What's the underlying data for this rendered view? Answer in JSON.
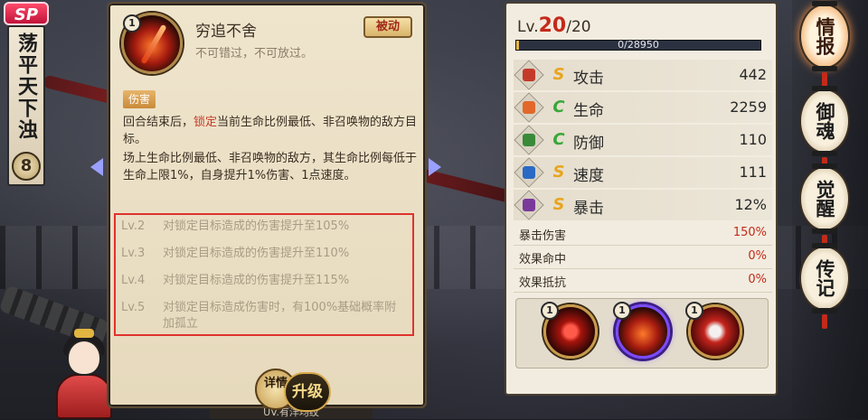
{
  "hero": {
    "rarity_badge": "SP",
    "name": "荡平天下浊",
    "badge_number": "8"
  },
  "background": {
    "plaque_text": "UV.有洋均纹"
  },
  "skill_card": {
    "level": "1",
    "title": "穷追不舍",
    "subtitle": "不可错过，不可放过。",
    "type_tag": "被动",
    "section_tag": "伤害",
    "desc_p1_before": "回合结束后，",
    "desc_p1_highlight": "锁定",
    "desc_p1_after": "当前生命比例最低、非召唤物的敌方目标。",
    "desc_p2": "场上生命比例最低、非召唤物的敌方，其生命比例每低于生命上限1%，自身提升1%伤害、1点速度。",
    "upgrades": [
      {
        "lv": "Lv.2",
        "text": "对锁定目标造成的伤害提升至105%"
      },
      {
        "lv": "Lv.3",
        "text": "对锁定目标造成的伤害提升至110%"
      },
      {
        "lv": "Lv.4",
        "text": "对锁定目标造成的伤害提升至115%"
      },
      {
        "lv": "Lv.5",
        "text": "对锁定目标造成伤害时，有100%基础概率附加孤立"
      }
    ],
    "detail_button": "详情",
    "upgrade_button": "升级"
  },
  "stats": {
    "lv_prefix": "Lv.",
    "level_current": "20",
    "level_max": "/20",
    "xp_text": "0/28950",
    "xp_fraction": 0.01,
    "rows": [
      {
        "icon": "attack-icon",
        "grade": "S",
        "label": "攻击",
        "value": "442",
        "grade_color": "#e8a51e",
        "icon_color": "#c43a2a"
      },
      {
        "icon": "health-icon",
        "grade": "C",
        "label": "生命",
        "value": "2259",
        "grade_color": "#37a83a",
        "icon_color": "#e2682a"
      },
      {
        "icon": "defense-icon",
        "grade": "C",
        "label": "防御",
        "value": "110",
        "grade_color": "#37a83a",
        "icon_color": "#3a8a3a"
      },
      {
        "icon": "speed-icon",
        "grade": "S",
        "label": "速度",
        "value": "111",
        "grade_color": "#e8a51e",
        "icon_color": "#2a6ac4"
      },
      {
        "icon": "crit-icon",
        "grade": "S",
        "label": "暴击",
        "value": "12%",
        "grade_color": "#e8a51e",
        "icon_color": "#7a3a9a"
      }
    ],
    "sub_rows": [
      {
        "label": "暴击伤害",
        "value": "150%"
      },
      {
        "label": "效果命中",
        "value": "0%"
      },
      {
        "label": "效果抵抗",
        "value": "0%"
      }
    ],
    "skills": [
      {
        "level": "1",
        "name": "skill-1-icon"
      },
      {
        "level": "1",
        "name": "skill-2-icon"
      },
      {
        "level": "1",
        "name": "skill-3-icon"
      }
    ]
  },
  "menu": {
    "items": [
      "情报",
      "御魂",
      "觉醒",
      "传记"
    ],
    "active_index": 0
  }
}
